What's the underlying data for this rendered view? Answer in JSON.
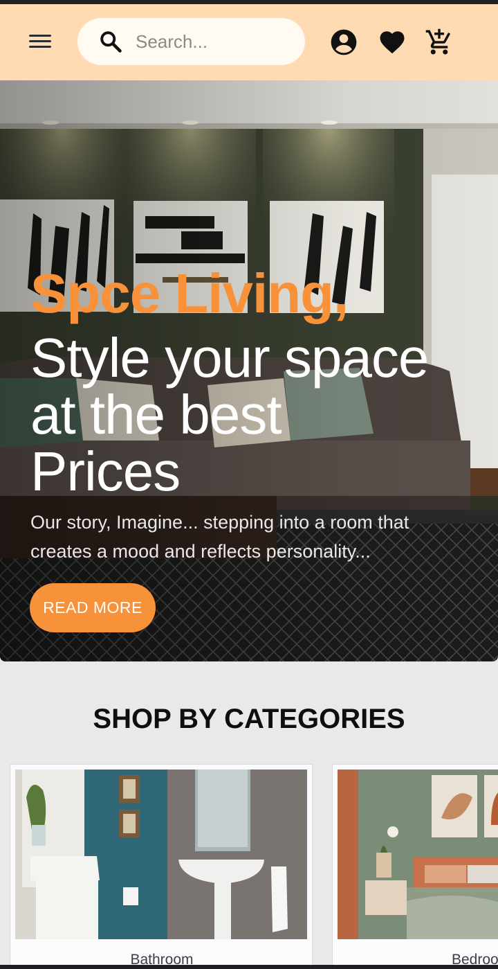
{
  "header": {
    "search_placeholder": "Search...",
    "icons": [
      "menu-icon",
      "search-icon",
      "account-circle-icon",
      "heart-icon",
      "add-shopping-cart-icon"
    ],
    "background_color": "#ffdbb3"
  },
  "hero": {
    "title_accent": "Spce Living,",
    "title": "Style your space at the best Prices",
    "subtitle": "Our story, Imagine... stepping into a room that creates a mood and reflects personality...",
    "cta_label": "READ MORE",
    "accent_color": "#f7923a"
  },
  "categories": {
    "title": "SHOP BY CATEGORIES",
    "items": [
      {
        "label": "Bathroom"
      },
      {
        "label": "Bedroo"
      }
    ]
  }
}
